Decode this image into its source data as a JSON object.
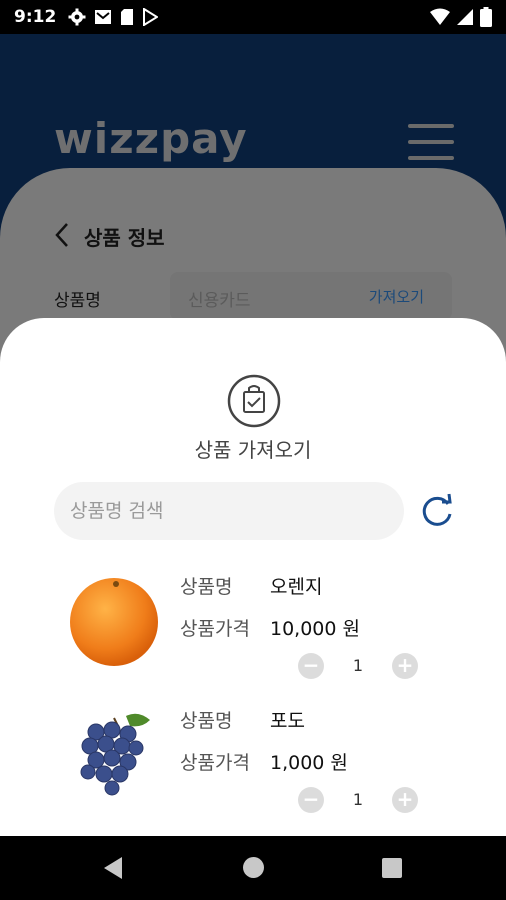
{
  "status_bar": {
    "time": "9:12"
  },
  "app": {
    "logo": "WIZZPAY"
  },
  "page": {
    "title": "상품 정보",
    "field_label": "상품명",
    "field_placeholder": "신용카드",
    "field_action": "가져오기"
  },
  "sheet": {
    "title": "상품 가져오기",
    "search_placeholder": "상품명 검색",
    "items": [
      {
        "name_label": "상품명",
        "name": "오렌지",
        "price_label": "상품가격",
        "price": "10,000 원",
        "qty": "1"
      },
      {
        "name_label": "상품명",
        "name": "포도",
        "price_label": "상품가격",
        "price": "1,000 원",
        "qty": "1"
      }
    ]
  },
  "colors": {
    "header_bg": "#081f3d",
    "accent": "#1a4d8f"
  },
  "icons": {
    "stepper_minus": "−",
    "stepper_plus": "+"
  }
}
